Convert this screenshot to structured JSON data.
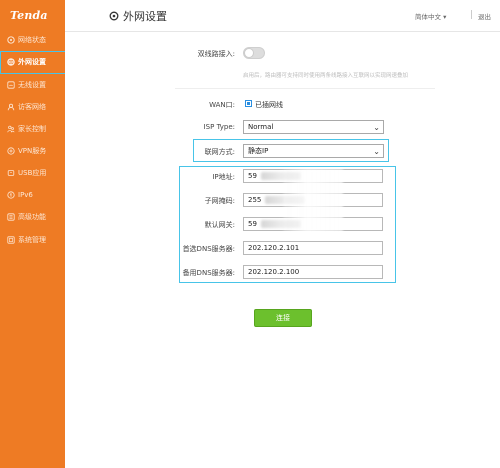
{
  "brand": {
    "logo_text": "Tenda",
    "accent": "#ee7b24",
    "highlight": "#48c4e8",
    "button_green": "#6cc02d"
  },
  "sidebar": {
    "items": [
      {
        "label": "网络状态",
        "icon": "network-status-icon"
      },
      {
        "label": "外网设置",
        "icon": "globe-icon",
        "active": true
      },
      {
        "label": "无线设置",
        "icon": "wifi-icon"
      },
      {
        "label": "访客网络",
        "icon": "guest-icon"
      },
      {
        "label": "家长控制",
        "icon": "parental-icon"
      },
      {
        "label": "VPN服务",
        "icon": "vpn-icon"
      },
      {
        "label": "USB应用",
        "icon": "usb-icon"
      },
      {
        "label": "IPv6",
        "icon": "ipv6-icon"
      },
      {
        "label": "高级功能",
        "icon": "advanced-icon"
      },
      {
        "label": "系统管理",
        "icon": "system-icon"
      }
    ]
  },
  "header": {
    "title": "外网设置",
    "language": "简体中文",
    "logout": "退出"
  },
  "dual_wan": {
    "label": "双线路接入:",
    "hint": "启用后，路由器可支持同时使用两条线路接入互联网以实现网速叠加"
  },
  "wan": {
    "label": "WAN口:",
    "status": "已插网线"
  },
  "isp": {
    "label": "ISP Type:",
    "value": "Normal"
  },
  "connection": {
    "label": "联网方式:",
    "value": "静态IP"
  },
  "fields": {
    "ip": {
      "label": "IP地址:",
      "value": "59"
    },
    "mask": {
      "label": "子网掩码:",
      "value": "255"
    },
    "gateway": {
      "label": "默认网关:",
      "value": "59"
    },
    "dns1": {
      "label": "首选DNS服务器:",
      "value": "202.120.2.101"
    },
    "dns2": {
      "label": "备用DNS服务器:",
      "value": "202.120.2.100"
    }
  },
  "actions": {
    "connect": "连接"
  }
}
